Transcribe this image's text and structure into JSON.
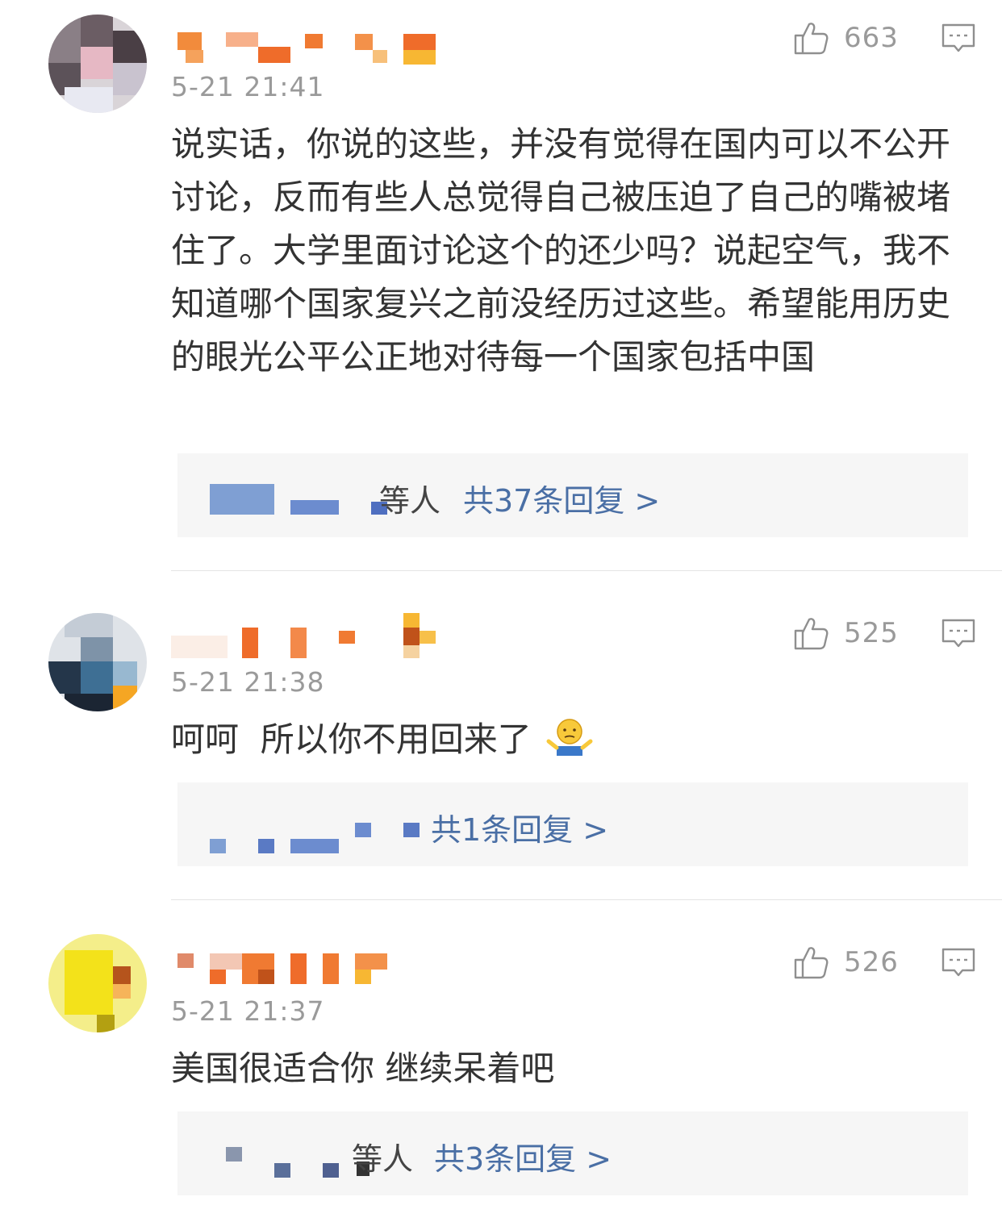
{
  "comments": [
    {
      "time": "5-21 21:41",
      "likes": "663",
      "text": "说实话，你说的这些，并没有觉得在国内可以不公开讨论，反而有些人总觉得自己被压迫了自己的嘴被堵住了。大学里面讨论这个的还少吗？说起空气，我不知道哪个国家复兴之前没经历过这些。希望能用历史的眼光公平公正地对待每一个国家包括中国",
      "reply_suffix": "等人",
      "reply_count": "共37条回复 >"
    },
    {
      "time": "5-21 21:38",
      "likes": "525",
      "text": "呵呵  所以你不用回来了",
      "reply_suffix": "",
      "reply_count": "共1条回复 >"
    },
    {
      "time": "5-21 21:37",
      "likes": "526",
      "text": "美国很适合你 继续呆着吧",
      "reply_suffix": "等人",
      "reply_count": "共3条回复 >"
    }
  ],
  "icons": {
    "like": "thumbs-up-icon",
    "reply": "comment-bubble-icon",
    "emoji": "shrug-emoji-icon"
  },
  "colors": {
    "link": "#4a6fa5",
    "meta": "#9a9a9a",
    "text": "#333333",
    "reply_bg": "#f6f6f6"
  }
}
